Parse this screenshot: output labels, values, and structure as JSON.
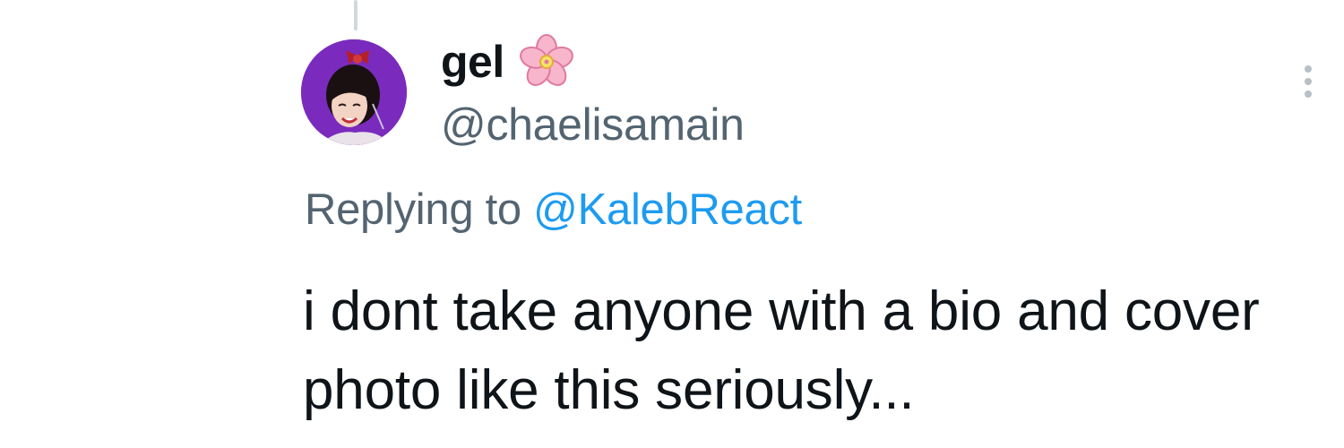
{
  "tweet": {
    "author": {
      "display_name": "gel",
      "name_emoji": "cherry-blossom-icon",
      "handle": "@chaelisamain",
      "avatar": "avatar"
    },
    "replying_prefix": "Replying to",
    "replying_to": "@KalebReact",
    "text": "i dont take anyone with a bio and cover photo like this seriously...",
    "more_icon": "more-options-icon"
  },
  "colors": {
    "text_primary": "#0f1419",
    "text_secondary": "#536471",
    "mention_blue": "#1d9bf0",
    "thread_line": "#cfd9de",
    "avatar_background": "#7a2bbd"
  }
}
